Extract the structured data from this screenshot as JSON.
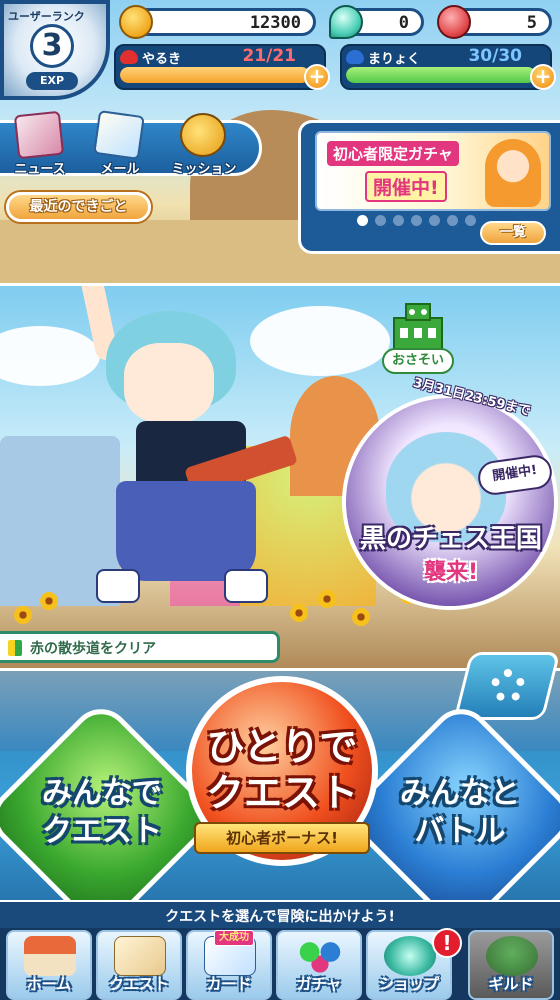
{
  "status": {
    "rank_label": "ユーザーランク",
    "rank_value": "3",
    "exp_label": "EXP",
    "coins": "12300",
    "gems": "0",
    "tickets": "5"
  },
  "stamina": {
    "yaruki_label": "やるき",
    "yaruki_value": "21/21",
    "yaruki_fraction": 1.0,
    "maryoku_label": "まりょく",
    "maryoku_value": "30/30",
    "maryoku_fraction": 1.0,
    "plus": "+"
  },
  "menu": {
    "news": "ニュース",
    "mail": "メール",
    "mission": "ミッション",
    "recent": "最近のできごと"
  },
  "gacha_banner": {
    "title": "初心者限定ガチャ",
    "subtitle": "開催中!",
    "list_button": "一覧",
    "page_count": 7,
    "active_page": 1
  },
  "event": {
    "invite_label": "おさそい",
    "deadline": "3月31日23:59まで",
    "open_badge": "開催中!",
    "title": "黒のチェス王国",
    "subtitle": "襲来!"
  },
  "progress": {
    "clear_text": "赤の散歩道をクリア"
  },
  "quest_buttons": {
    "multi_line1": "みんなで",
    "multi_line2": "クエスト",
    "solo_line1": "ひとりで",
    "solo_line2": "クエスト",
    "bonus": "初心者ボーナス!",
    "battle_line1": "みんなと",
    "battle_line2": "バトル"
  },
  "hint": "クエストを選んで冒険に出かけよう!",
  "navbar": {
    "home": "ホーム",
    "quest": "クエスト",
    "card": "カード",
    "card_badge": "大成功",
    "gacha": "ガチャ",
    "shop": "ショップ",
    "shop_alert": "!",
    "guild": "ギルド"
  },
  "icons": {
    "settings": "gear-icon",
    "coin": "coin-icon",
    "gem": "gem-icon",
    "ticket": "meat-icon"
  },
  "colors": {
    "panel_blue": "#1c4f86",
    "yaruki_fill": "#f5a32a",
    "maryoku_fill": "#52c84a",
    "accent_pink": "#e2367e"
  }
}
